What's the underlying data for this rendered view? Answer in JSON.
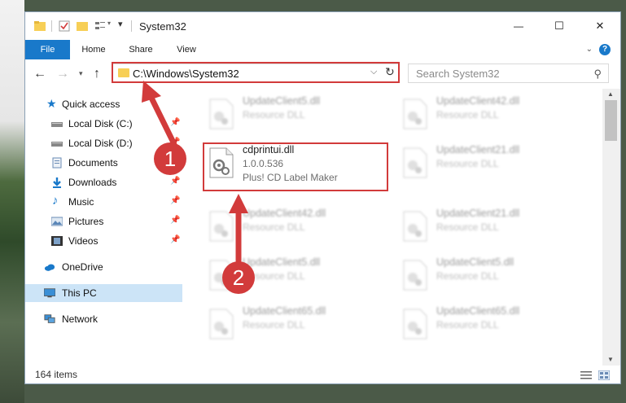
{
  "window": {
    "title": "System32",
    "controls": {
      "minimize": "—",
      "maximize": "☐",
      "close": "✕"
    }
  },
  "ribbon": {
    "tabs": [
      "File",
      "Home",
      "Share",
      "View"
    ],
    "help": "?"
  },
  "nav": {
    "address": "C:\\Windows\\System32",
    "search_placeholder": "Search System32"
  },
  "sidebar": {
    "items": [
      {
        "label": "Quick access",
        "icon": "star-icon",
        "pinned": false
      },
      {
        "label": "Local Disk (C:)",
        "icon": "drive-icon",
        "pinned": true
      },
      {
        "label": "Local Disk (D:)",
        "icon": "drive-icon",
        "pinned": true
      },
      {
        "label": "Documents",
        "icon": "documents-icon",
        "pinned": true
      },
      {
        "label": "Downloads",
        "icon": "download-icon",
        "pinned": true
      },
      {
        "label": "Music",
        "icon": "music-icon",
        "pinned": true
      },
      {
        "label": "Pictures",
        "icon": "pictures-icon",
        "pinned": true
      },
      {
        "label": "Videos",
        "icon": "videos-icon",
        "pinned": true
      },
      {
        "label": "OneDrive",
        "icon": "cloud-icon",
        "pinned": false
      },
      {
        "label": "This PC",
        "icon": "computer-icon",
        "pinned": false,
        "selected": true
      },
      {
        "label": "Network",
        "icon": "network-icon",
        "pinned": false
      }
    ]
  },
  "files": {
    "left": [
      {
        "name": "UpdateClient5.dll",
        "desc": "Resource DLL"
      },
      {
        "name": "cdprintui.dll",
        "version": "1.0.0.536",
        "desc": "Plus! CD Label Maker",
        "highlighted": true
      },
      {
        "name": "UpdateClient42.dll",
        "desc": "Resource DLL"
      },
      {
        "name": "UpdateClient5.dll",
        "desc": "Resource DLL"
      },
      {
        "name": "UpdateClient65.dll",
        "desc": "Resource DLL"
      }
    ],
    "right": [
      {
        "name": "UpdateClient42.dll",
        "desc": "Resource DLL"
      },
      {
        "name": "UpdateClient21.dll",
        "desc": "Resource DLL"
      },
      {
        "name": "UpdateClient21.dll",
        "desc": "Resource DLL"
      },
      {
        "name": "UpdateClient5.dll",
        "desc": "Resource DLL"
      },
      {
        "name": "UpdateClient65.dll",
        "desc": "Resource DLL"
      }
    ]
  },
  "status": {
    "item_count": "164 items"
  },
  "annotations": {
    "step1": "1",
    "step2": "2"
  },
  "colors": {
    "accent": "#1979ca",
    "highlight": "#d23b3b",
    "selected_bg": "#cce4f7"
  }
}
